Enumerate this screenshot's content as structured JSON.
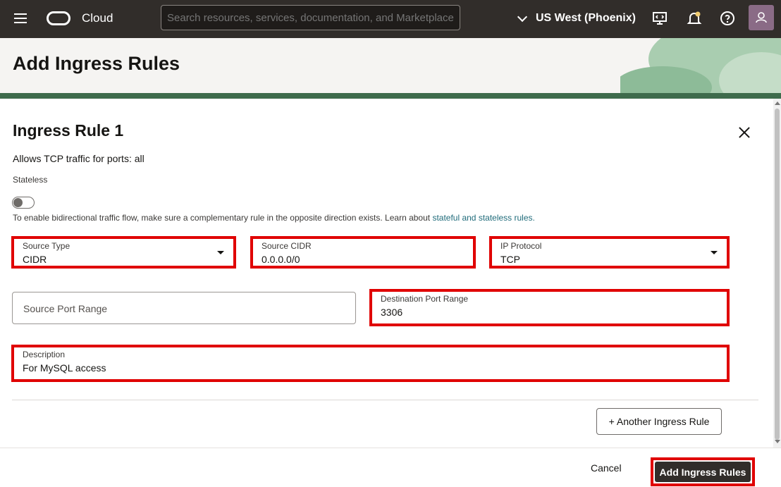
{
  "topbar": {
    "brand": "Cloud",
    "search_placeholder": "Search resources, services, documentation, and Marketplace",
    "region": "US West (Phoenix)",
    "icons": [
      "menu-icon",
      "oracle-logo-icon",
      "chevron-down-icon",
      "cloud-shell-icon",
      "bell-icon",
      "help-icon",
      "user-icon"
    ]
  },
  "header": {
    "title": "Add Ingress Rules"
  },
  "rule": {
    "title": "Ingress Rule 1",
    "summary": "Allows TCP traffic for ports: all",
    "stateless_label": "Stateless",
    "stateless_on": false,
    "hint_text": "To enable bidirectional traffic flow, make sure a complementary rule in the opposite direction exists. Learn about ",
    "hint_link": "stateful and stateless rules.",
    "source_type": {
      "label": "Source Type",
      "value": "CIDR"
    },
    "source_cidr": {
      "label": "Source CIDR",
      "value": "0.0.0.0/0"
    },
    "ip_protocol": {
      "label": "IP Protocol",
      "value": "TCP"
    },
    "source_port_range": {
      "placeholder": "Source Port Range"
    },
    "destination_port_range": {
      "label": "Destination Port Range",
      "value": "3306"
    },
    "description": {
      "label": "Description",
      "value": "For MySQL access"
    },
    "another_rule_label": "+ Another Ingress Rule"
  },
  "footer": {
    "cancel_label": "Cancel",
    "submit_label": "Add Ingress Rules"
  },
  "colors": {
    "topbar_bg": "#312d2a",
    "highlight_red": "#e00000",
    "link_teal": "#1f6b7a",
    "primary_button": "#312d2a"
  }
}
